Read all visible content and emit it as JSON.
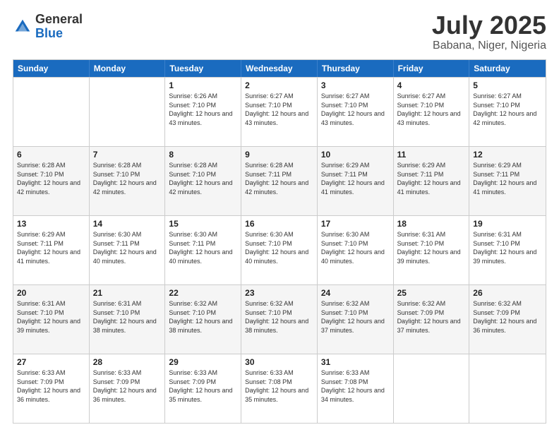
{
  "logo": {
    "general": "General",
    "blue": "Blue"
  },
  "header": {
    "month": "July 2025",
    "location": "Babana, Niger, Nigeria"
  },
  "days": [
    "Sunday",
    "Monday",
    "Tuesday",
    "Wednesday",
    "Thursday",
    "Friday",
    "Saturday"
  ],
  "weeks": [
    [
      {
        "day": "",
        "sunrise": "",
        "sunset": "",
        "daylight": ""
      },
      {
        "day": "",
        "sunrise": "",
        "sunset": "",
        "daylight": ""
      },
      {
        "day": "1",
        "sunrise": "Sunrise: 6:26 AM",
        "sunset": "Sunset: 7:10 PM",
        "daylight": "Daylight: 12 hours and 43 minutes."
      },
      {
        "day": "2",
        "sunrise": "Sunrise: 6:27 AM",
        "sunset": "Sunset: 7:10 PM",
        "daylight": "Daylight: 12 hours and 43 minutes."
      },
      {
        "day": "3",
        "sunrise": "Sunrise: 6:27 AM",
        "sunset": "Sunset: 7:10 PM",
        "daylight": "Daylight: 12 hours and 43 minutes."
      },
      {
        "day": "4",
        "sunrise": "Sunrise: 6:27 AM",
        "sunset": "Sunset: 7:10 PM",
        "daylight": "Daylight: 12 hours and 43 minutes."
      },
      {
        "day": "5",
        "sunrise": "Sunrise: 6:27 AM",
        "sunset": "Sunset: 7:10 PM",
        "daylight": "Daylight: 12 hours and 42 minutes."
      }
    ],
    [
      {
        "day": "6",
        "sunrise": "Sunrise: 6:28 AM",
        "sunset": "Sunset: 7:10 PM",
        "daylight": "Daylight: 12 hours and 42 minutes."
      },
      {
        "day": "7",
        "sunrise": "Sunrise: 6:28 AM",
        "sunset": "Sunset: 7:10 PM",
        "daylight": "Daylight: 12 hours and 42 minutes."
      },
      {
        "day": "8",
        "sunrise": "Sunrise: 6:28 AM",
        "sunset": "Sunset: 7:10 PM",
        "daylight": "Daylight: 12 hours and 42 minutes."
      },
      {
        "day": "9",
        "sunrise": "Sunrise: 6:28 AM",
        "sunset": "Sunset: 7:11 PM",
        "daylight": "Daylight: 12 hours and 42 minutes."
      },
      {
        "day": "10",
        "sunrise": "Sunrise: 6:29 AM",
        "sunset": "Sunset: 7:11 PM",
        "daylight": "Daylight: 12 hours and 41 minutes."
      },
      {
        "day": "11",
        "sunrise": "Sunrise: 6:29 AM",
        "sunset": "Sunset: 7:11 PM",
        "daylight": "Daylight: 12 hours and 41 minutes."
      },
      {
        "day": "12",
        "sunrise": "Sunrise: 6:29 AM",
        "sunset": "Sunset: 7:11 PM",
        "daylight": "Daylight: 12 hours and 41 minutes."
      }
    ],
    [
      {
        "day": "13",
        "sunrise": "Sunrise: 6:29 AM",
        "sunset": "Sunset: 7:11 PM",
        "daylight": "Daylight: 12 hours and 41 minutes."
      },
      {
        "day": "14",
        "sunrise": "Sunrise: 6:30 AM",
        "sunset": "Sunset: 7:11 PM",
        "daylight": "Daylight: 12 hours and 40 minutes."
      },
      {
        "day": "15",
        "sunrise": "Sunrise: 6:30 AM",
        "sunset": "Sunset: 7:11 PM",
        "daylight": "Daylight: 12 hours and 40 minutes."
      },
      {
        "day": "16",
        "sunrise": "Sunrise: 6:30 AM",
        "sunset": "Sunset: 7:10 PM",
        "daylight": "Daylight: 12 hours and 40 minutes."
      },
      {
        "day": "17",
        "sunrise": "Sunrise: 6:30 AM",
        "sunset": "Sunset: 7:10 PM",
        "daylight": "Daylight: 12 hours and 40 minutes."
      },
      {
        "day": "18",
        "sunrise": "Sunrise: 6:31 AM",
        "sunset": "Sunset: 7:10 PM",
        "daylight": "Daylight: 12 hours and 39 minutes."
      },
      {
        "day": "19",
        "sunrise": "Sunrise: 6:31 AM",
        "sunset": "Sunset: 7:10 PM",
        "daylight": "Daylight: 12 hours and 39 minutes."
      }
    ],
    [
      {
        "day": "20",
        "sunrise": "Sunrise: 6:31 AM",
        "sunset": "Sunset: 7:10 PM",
        "daylight": "Daylight: 12 hours and 39 minutes."
      },
      {
        "day": "21",
        "sunrise": "Sunrise: 6:31 AM",
        "sunset": "Sunset: 7:10 PM",
        "daylight": "Daylight: 12 hours and 38 minutes."
      },
      {
        "day": "22",
        "sunrise": "Sunrise: 6:32 AM",
        "sunset": "Sunset: 7:10 PM",
        "daylight": "Daylight: 12 hours and 38 minutes."
      },
      {
        "day": "23",
        "sunrise": "Sunrise: 6:32 AM",
        "sunset": "Sunset: 7:10 PM",
        "daylight": "Daylight: 12 hours and 38 minutes."
      },
      {
        "day": "24",
        "sunrise": "Sunrise: 6:32 AM",
        "sunset": "Sunset: 7:10 PM",
        "daylight": "Daylight: 12 hours and 37 minutes."
      },
      {
        "day": "25",
        "sunrise": "Sunrise: 6:32 AM",
        "sunset": "Sunset: 7:09 PM",
        "daylight": "Daylight: 12 hours and 37 minutes."
      },
      {
        "day": "26",
        "sunrise": "Sunrise: 6:32 AM",
        "sunset": "Sunset: 7:09 PM",
        "daylight": "Daylight: 12 hours and 36 minutes."
      }
    ],
    [
      {
        "day": "27",
        "sunrise": "Sunrise: 6:33 AM",
        "sunset": "Sunset: 7:09 PM",
        "daylight": "Daylight: 12 hours and 36 minutes."
      },
      {
        "day": "28",
        "sunrise": "Sunrise: 6:33 AM",
        "sunset": "Sunset: 7:09 PM",
        "daylight": "Daylight: 12 hours and 36 minutes."
      },
      {
        "day": "29",
        "sunrise": "Sunrise: 6:33 AM",
        "sunset": "Sunset: 7:09 PM",
        "daylight": "Daylight: 12 hours and 35 minutes."
      },
      {
        "day": "30",
        "sunrise": "Sunrise: 6:33 AM",
        "sunset": "Sunset: 7:08 PM",
        "daylight": "Daylight: 12 hours and 35 minutes."
      },
      {
        "day": "31",
        "sunrise": "Sunrise: 6:33 AM",
        "sunset": "Sunset: 7:08 PM",
        "daylight": "Daylight: 12 hours and 34 minutes."
      },
      {
        "day": "",
        "sunrise": "",
        "sunset": "",
        "daylight": ""
      },
      {
        "day": "",
        "sunrise": "",
        "sunset": "",
        "daylight": ""
      }
    ]
  ]
}
